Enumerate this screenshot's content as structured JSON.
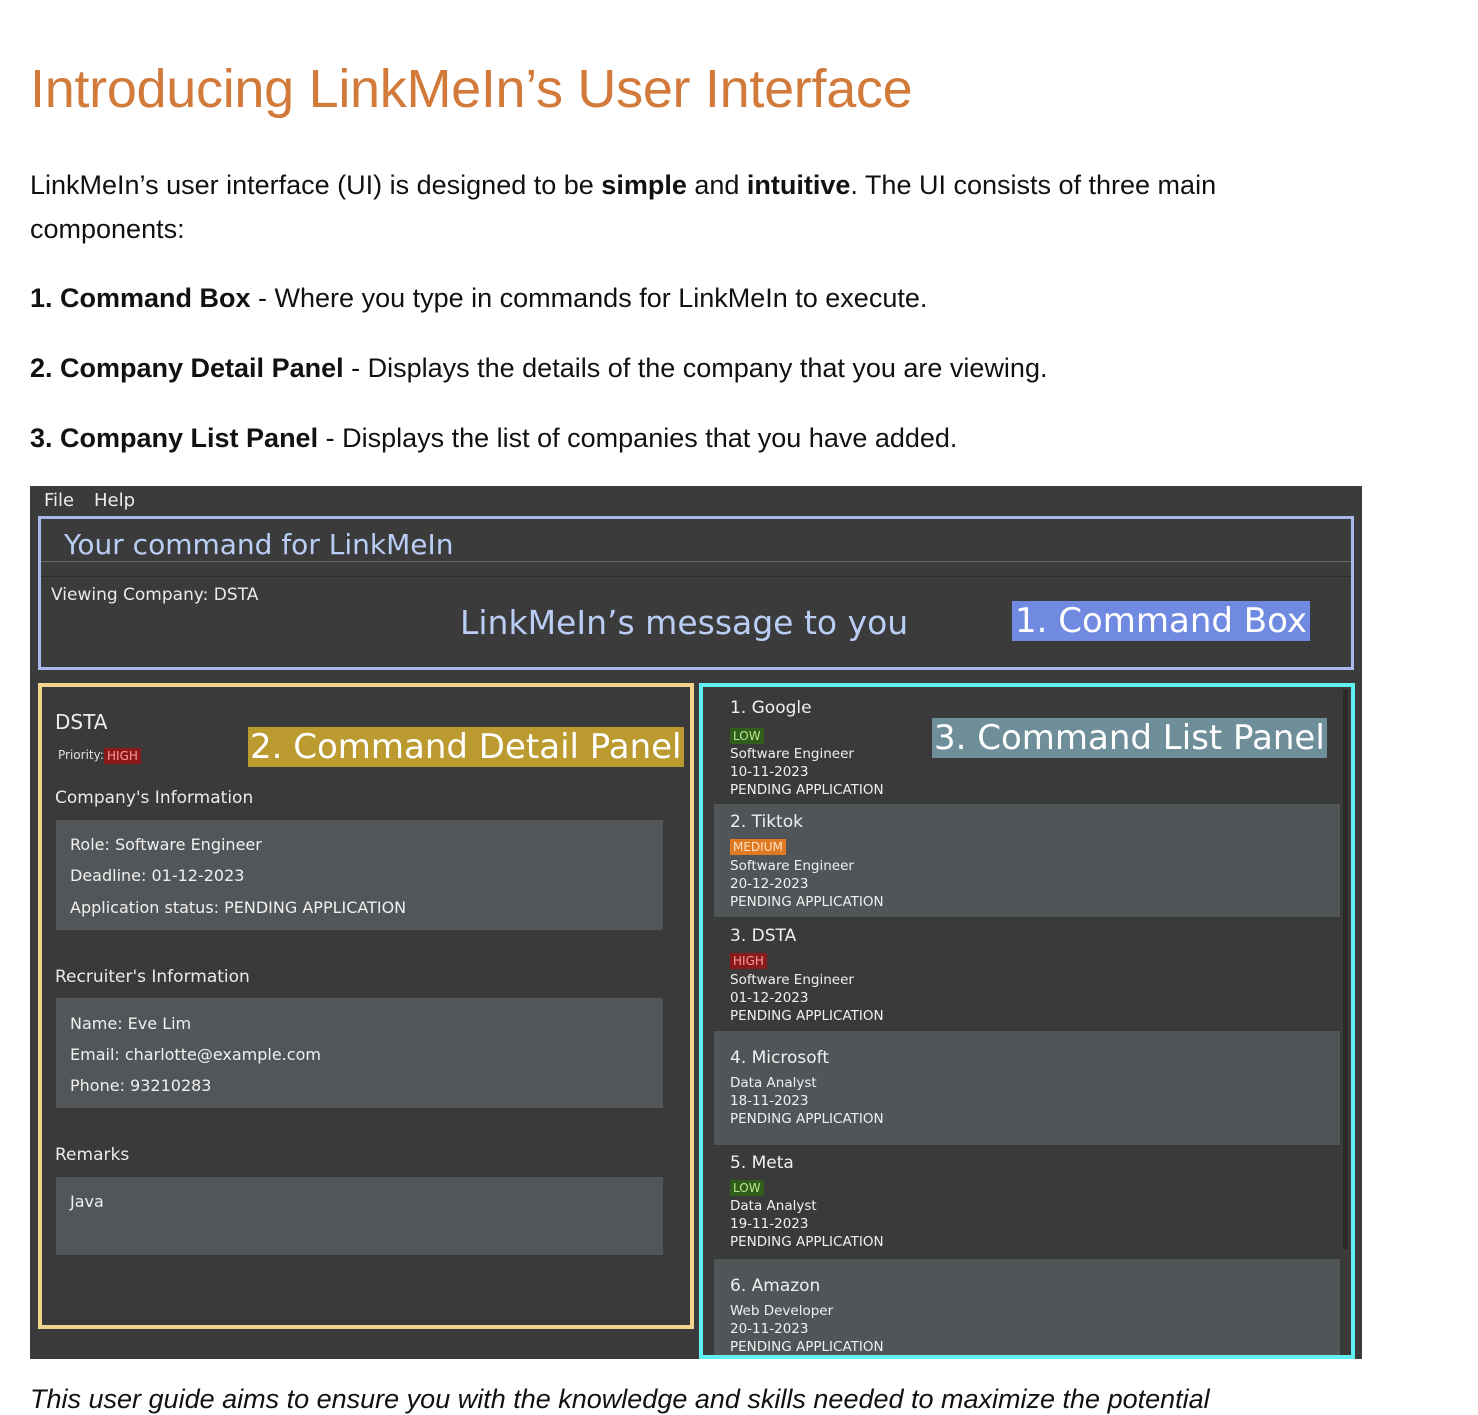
{
  "doc": {
    "title": "Introducing LinkMeIn’s User Interface",
    "intro_a": "LinkMeIn’s user interface (UI) is designed to be ",
    "intro_b": "simple",
    "intro_c": " and ",
    "intro_d": "intuitive",
    "intro_e": ". The UI consists of three main components:",
    "items": [
      {
        "label": "1. Command Box",
        "desc": " - Where you type in commands for LinkMeIn to execute."
      },
      {
        "label": "2. Company Detail Panel",
        "desc": " - Displays the details of the company that you are viewing."
      },
      {
        "label": "3. Company List Panel",
        "desc": " - Displays the list of companies that you have added."
      }
    ],
    "trailing": "This user guide aims to ensure you with the knowledge and skills needed to maximize the potential"
  },
  "app": {
    "menu": [
      "File",
      "Help"
    ],
    "command_placeholder": "Your command for LinkMeIn",
    "viewing": "Viewing Company: DSTA",
    "message_label": "LinkMeIn’s message to you",
    "tags": {
      "command_box": "1. Command Box",
      "detail_panel": "2. Command Detail Panel",
      "list_panel": "3. Command List Panel"
    },
    "colors": {
      "blue_box": "#a9b9ee",
      "yellow_box": "#f4d38c",
      "cyan_box": "#5ef0f3",
      "title": "#d27a3a"
    },
    "detail": {
      "name": "DSTA",
      "priority_label": "Priority:",
      "priority": "HIGH",
      "company_head": "Company's Information",
      "role": "Role: Software Engineer",
      "deadline": "Deadline: 01-12-2023",
      "status": "Application status: PENDING APPLICATION",
      "recruiter_head": "Recruiter's Information",
      "rec_name": "Name: Eve Lim",
      "rec_email": "Email: charlotte@example.com",
      "rec_phone": "Phone: 93210283",
      "remarks_head": "Remarks",
      "remarks": "Java"
    },
    "list": [
      {
        "title": "1.  Google",
        "priority": "LOW",
        "role": "Software Engineer",
        "date": "10-11-2023",
        "status": "PENDING APPLICATION"
      },
      {
        "title": "2.  Tiktok",
        "priority": "MEDIUM",
        "role": "Software Engineer",
        "date": "20-12-2023",
        "status": "PENDING APPLICATION"
      },
      {
        "title": "3.  DSTA",
        "priority": "HIGH",
        "role": "Software Engineer",
        "date": "01-12-2023",
        "status": "PENDING APPLICATION"
      },
      {
        "title": "4.  Microsoft",
        "priority": "",
        "role": "Data Analyst",
        "date": "18-11-2023",
        "status": "PENDING APPLICATION"
      },
      {
        "title": "5.  Meta",
        "priority": "LOW",
        "role": "Data Analyst",
        "date": "19-11-2023",
        "status": "PENDING APPLICATION"
      },
      {
        "title": "6.  Amazon",
        "priority": "",
        "role": "Web Developer",
        "date": "20-11-2023",
        "status": "PENDING APPLICATION"
      }
    ]
  }
}
